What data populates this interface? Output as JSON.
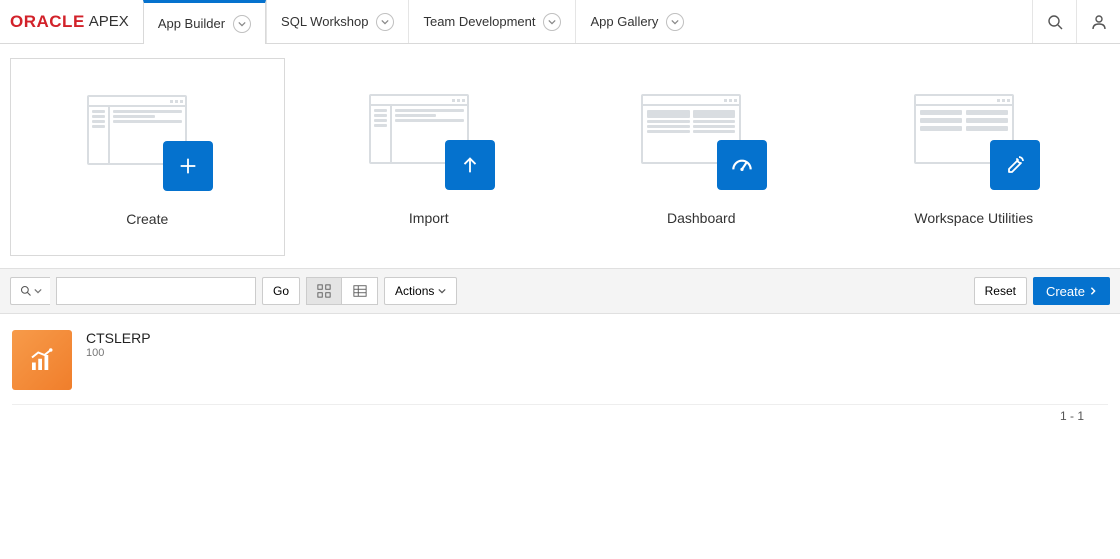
{
  "brand": {
    "oracle": "ORACLE",
    "apex": "APEX"
  },
  "nav": {
    "tabs": [
      {
        "label": "App Builder"
      },
      {
        "label": "SQL Workshop"
      },
      {
        "label": "Team Development"
      },
      {
        "label": "App Gallery"
      }
    ]
  },
  "cards": {
    "create": "Create",
    "import": "Import",
    "dashboard": "Dashboard",
    "utilities": "Workspace Utilities"
  },
  "toolbar": {
    "go": "Go",
    "actions": "Actions",
    "reset": "Reset",
    "create": "Create",
    "search_placeholder": ""
  },
  "apps": [
    {
      "name": "CTSLERP",
      "id": "100"
    }
  ],
  "pager": "1 - 1"
}
